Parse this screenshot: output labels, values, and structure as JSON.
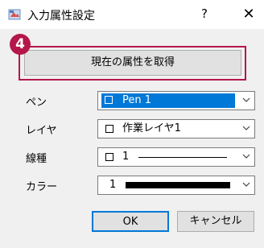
{
  "window": {
    "title": "入力属性設定",
    "help_label": "?",
    "close_label": "✕"
  },
  "annotation": {
    "step_number": "4"
  },
  "get_attributes_button": "現在の属性を取得",
  "fields": {
    "pen": {
      "label": "ペン",
      "value": "Pen 1"
    },
    "layer": {
      "label": "レイヤ",
      "value": "作業レイヤ1"
    },
    "linetype": {
      "label": "線種",
      "value": "1"
    },
    "color": {
      "label": "カラー",
      "value": "1",
      "swatch": "#000000"
    }
  },
  "buttons": {
    "ok": "OK",
    "cancel": "キャンセル"
  },
  "colors": {
    "accent": "#0078d7",
    "badge": "#b5174a"
  }
}
